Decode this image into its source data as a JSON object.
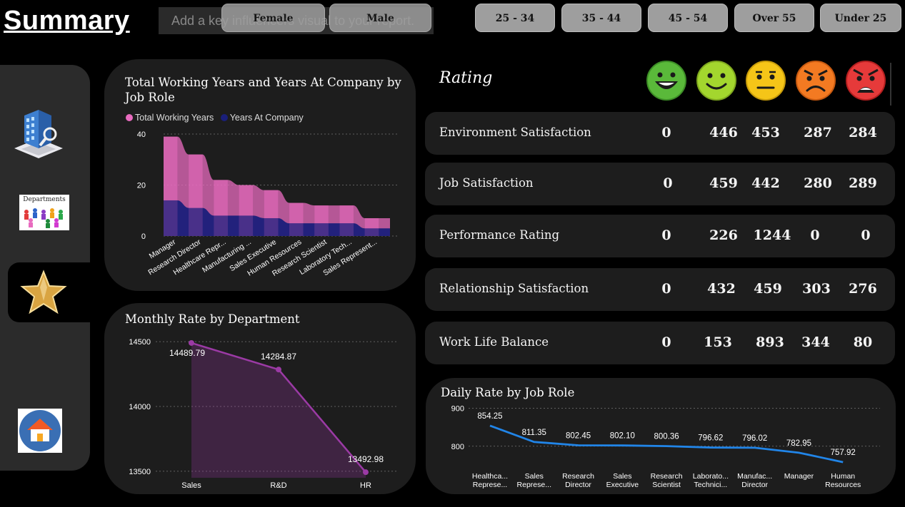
{
  "header": {
    "title": "Summary",
    "key_influencer_placeholder": "Add a key influencers visual to your report."
  },
  "gender_slicer": [
    "Female",
    "Male"
  ],
  "age_slicer": [
    "25 - 34",
    "35 - 44",
    "45 - 54",
    "Over 55",
    "Under 25"
  ],
  "sidebar": {
    "items": [
      {
        "name": "building-analytics",
        "icon": "building-magnifier-icon"
      },
      {
        "name": "departments",
        "label": "Departments",
        "icon": "departments-icon"
      },
      {
        "name": "rating",
        "icon": "star-icon",
        "selected": true
      },
      {
        "name": "home",
        "icon": "home-icon"
      }
    ]
  },
  "ratings": {
    "title": "Rating",
    "faces": [
      "very-happy-face-icon",
      "happy-face-icon",
      "neutral-face-icon",
      "angry-face-icon",
      "furious-face-icon"
    ],
    "face_colors": [
      "#5ab93a",
      "#a3d62e",
      "#f5c518",
      "#f37a22",
      "#e63a3a"
    ],
    "rows": [
      {
        "label": "Environment Satisfaction",
        "values": [
          "0",
          "446",
          "453",
          "287",
          "284"
        ]
      },
      {
        "label": "Job Satisfaction",
        "values": [
          "0",
          "459",
          "442",
          "280",
          "289"
        ]
      },
      {
        "label": "Performance Rating",
        "values": [
          "0",
          "226",
          "1244",
          "0",
          "0"
        ]
      },
      {
        "label": "Relationship Satisfaction",
        "values": [
          "0",
          "432",
          "459",
          "303",
          "276"
        ]
      },
      {
        "label": "Work Life Balance",
        "values": [
          "0",
          "153",
          "893",
          "344",
          "80"
        ]
      }
    ]
  },
  "chart_data": [
    {
      "type": "area",
      "title": "Total Working Years and Years At Company by Job Role",
      "categories": [
        "Manager",
        "Research Director",
        "Healthcare Repr...",
        "Manufacturing ...",
        "Sales Executive",
        "Human Resources",
        "Research Scientist",
        "Laboratory Tech...",
        "Sales Represent..."
      ],
      "series": [
        {
          "name": "Total Working Years",
          "color": "#e86bbf",
          "values": [
            39,
            32,
            22,
            20,
            18,
            13,
            12,
            12,
            7
          ]
        },
        {
          "name": "Years At Company",
          "color": "#1a1f7a",
          "values": [
            14,
            11,
            8,
            8,
            7,
            5,
            5,
            5,
            3
          ]
        }
      ],
      "y_ticks": [
        "0",
        "20",
        "40"
      ],
      "ylim": [
        0,
        40
      ],
      "legend": "top-left",
      "grid": true
    },
    {
      "type": "line",
      "title": "Monthly Rate by Department",
      "categories": [
        "Sales",
        "R&D",
        "HR"
      ],
      "values": [
        14489.79,
        14284.87,
        13492.98
      ],
      "value_labels": [
        "14489.79",
        "14284.87",
        "13492.98"
      ],
      "y_ticks": [
        "13500",
        "14000",
        "14500"
      ],
      "ylim": [
        13450,
        14550
      ],
      "color": "#9b3aa5",
      "grid": true
    },
    {
      "type": "line",
      "title": "Daily Rate by Job Role",
      "categories": [
        "Healthca... Represe...",
        "Sales Represe...",
        "Research Director",
        "Sales Executive",
        "Research Scientist",
        "Laborato... Technici...",
        "Manufac... Director",
        "Manager",
        "Human Resources"
      ],
      "values": [
        854.25,
        811.35,
        802.45,
        802.1,
        800.36,
        796.62,
        796.02,
        782.95,
        757.92
      ],
      "value_labels": [
        "854.25",
        "811.35",
        "802.45",
        "802.10",
        "800.36",
        "796.62",
        "796.02",
        "782.95",
        "757.92"
      ],
      "y_ticks": [
        "800",
        "900"
      ],
      "ylim": [
        745,
        905
      ],
      "color": "#2185e8",
      "grid": true
    }
  ]
}
